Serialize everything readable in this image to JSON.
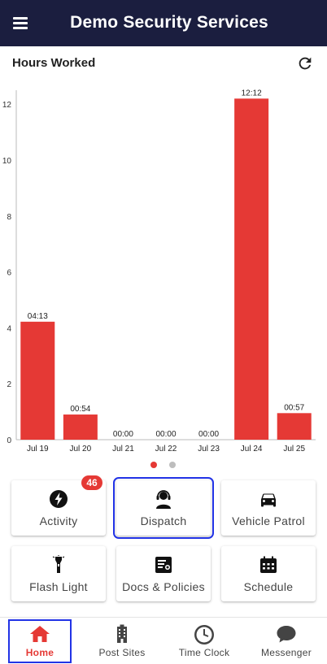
{
  "app_bar": {
    "title": "Demo Security Services",
    "menu_icon": "hamburger-menu-icon"
  },
  "section": {
    "title": "Hours Worked",
    "refresh_icon": "refresh-icon"
  },
  "colors": {
    "app_bar": "#1b1e3f",
    "accent": "#e53935",
    "bar": "#e53935",
    "selection_outline": "#2233e6",
    "dot_inactive": "#bdbdbd"
  },
  "chart_data": {
    "type": "bar",
    "categories": [
      "Jul 19",
      "Jul 20",
      "Jul 21",
      "Jul 22",
      "Jul 23",
      "Jul 24",
      "Jul 25"
    ],
    "values": [
      4.22,
      0.9,
      0,
      0,
      0,
      12.2,
      0.95
    ],
    "data_labels": [
      "04:13",
      "00:54",
      "00:00",
      "00:00",
      "00:00",
      "12:12",
      "00:57"
    ],
    "y_ticks": [
      0,
      2,
      4,
      6,
      8,
      10,
      12
    ],
    "ylim": [
      0,
      12.5
    ],
    "grid": false,
    "legend": "none"
  },
  "pager": {
    "count": 2,
    "active_index": 0
  },
  "tiles": [
    {
      "label": "Activity",
      "icon": "lightning-bolt-icon",
      "badge": "46"
    },
    {
      "label": "Dispatch",
      "icon": "dispatcher-headset-icon",
      "selected": true
    },
    {
      "label": "Vehicle Patrol",
      "icon": "car-icon"
    },
    {
      "label": "Flash Light",
      "icon": "flashlight-icon"
    },
    {
      "label": "Docs & Policies",
      "icon": "document-icon"
    },
    {
      "label": "Schedule",
      "icon": "calendar-icon"
    }
  ],
  "bottom_nav": [
    {
      "label": "Home",
      "icon": "home-icon",
      "active": true
    },
    {
      "label": "Post Sites",
      "icon": "building-icon"
    },
    {
      "label": "Time Clock",
      "icon": "clock-icon"
    },
    {
      "label": "Messenger",
      "icon": "chat-bubble-icon"
    }
  ]
}
